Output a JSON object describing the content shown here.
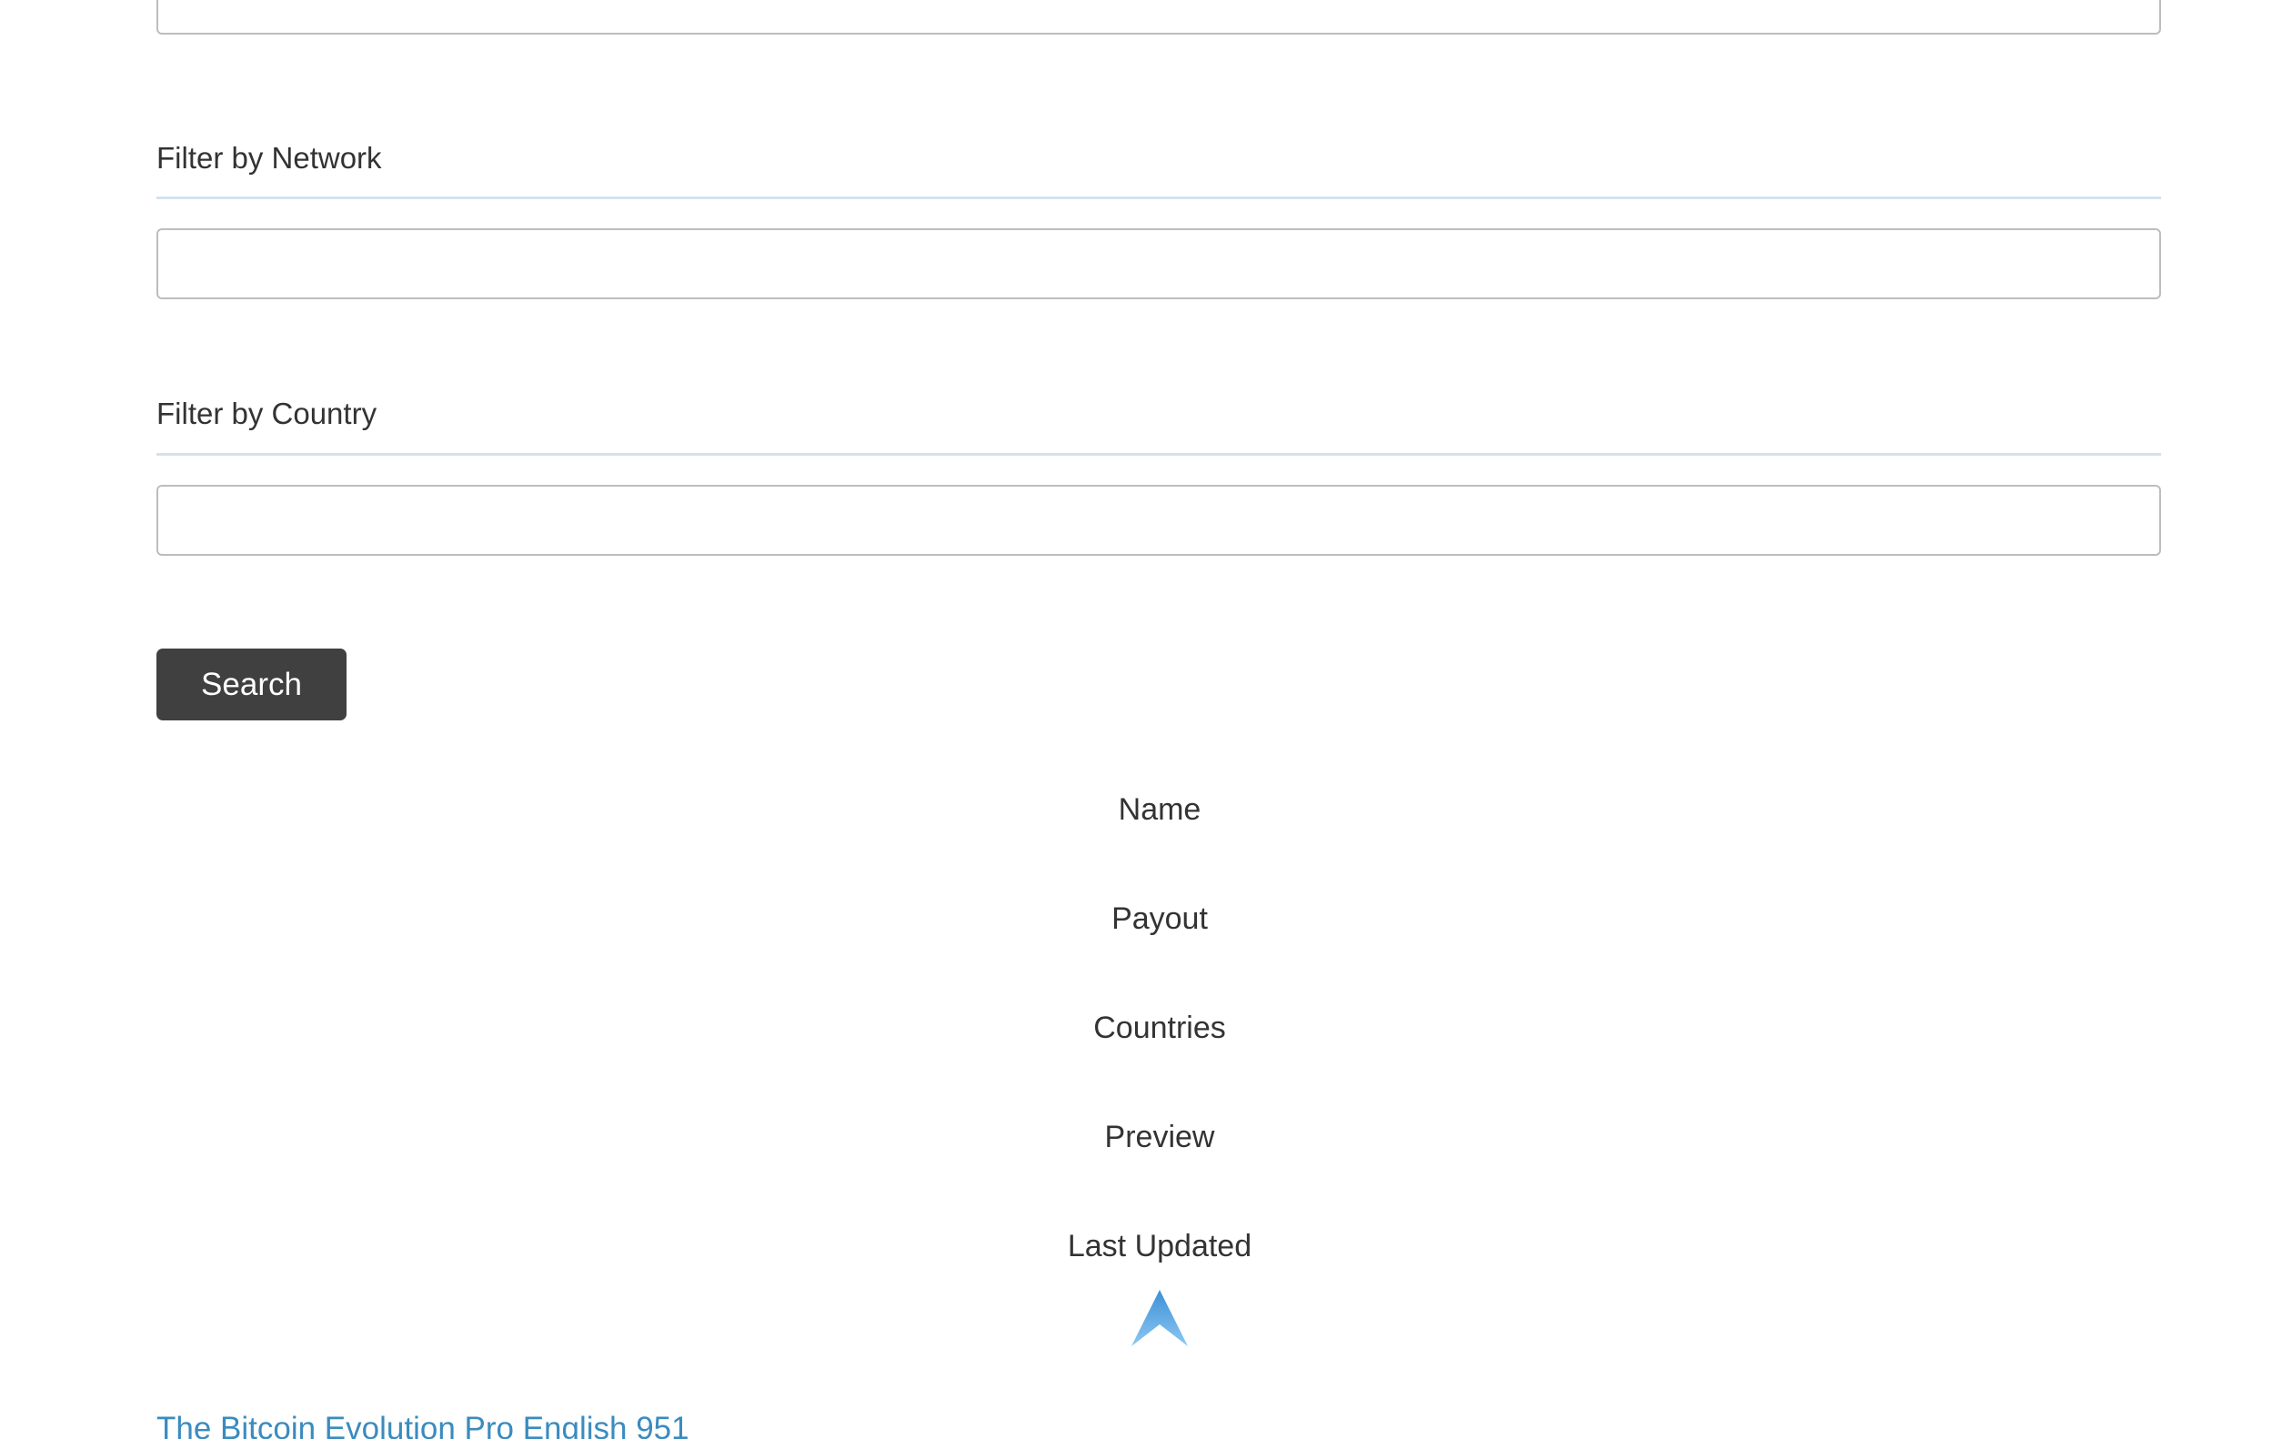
{
  "filters": {
    "top_field": {
      "value": ""
    },
    "network": {
      "label": "Filter by Network",
      "value": ""
    },
    "country": {
      "label": "Filter by Country",
      "value": ""
    }
  },
  "search_button": {
    "label": "Search"
  },
  "columns": [
    {
      "label": "Name"
    },
    {
      "label": "Payout"
    },
    {
      "label": "Countries"
    },
    {
      "label": "Preview"
    },
    {
      "label": "Last Updated"
    }
  ],
  "sort_icon": {
    "name": "chevron-up-icon",
    "color": "#4a9fe0"
  },
  "results": [
    {
      "name": "The Bitcoin Evolution Pro English 951"
    }
  ],
  "colors": {
    "button_bg": "#404040",
    "link": "#3a8bbf",
    "rule": "#d3e2f1"
  }
}
